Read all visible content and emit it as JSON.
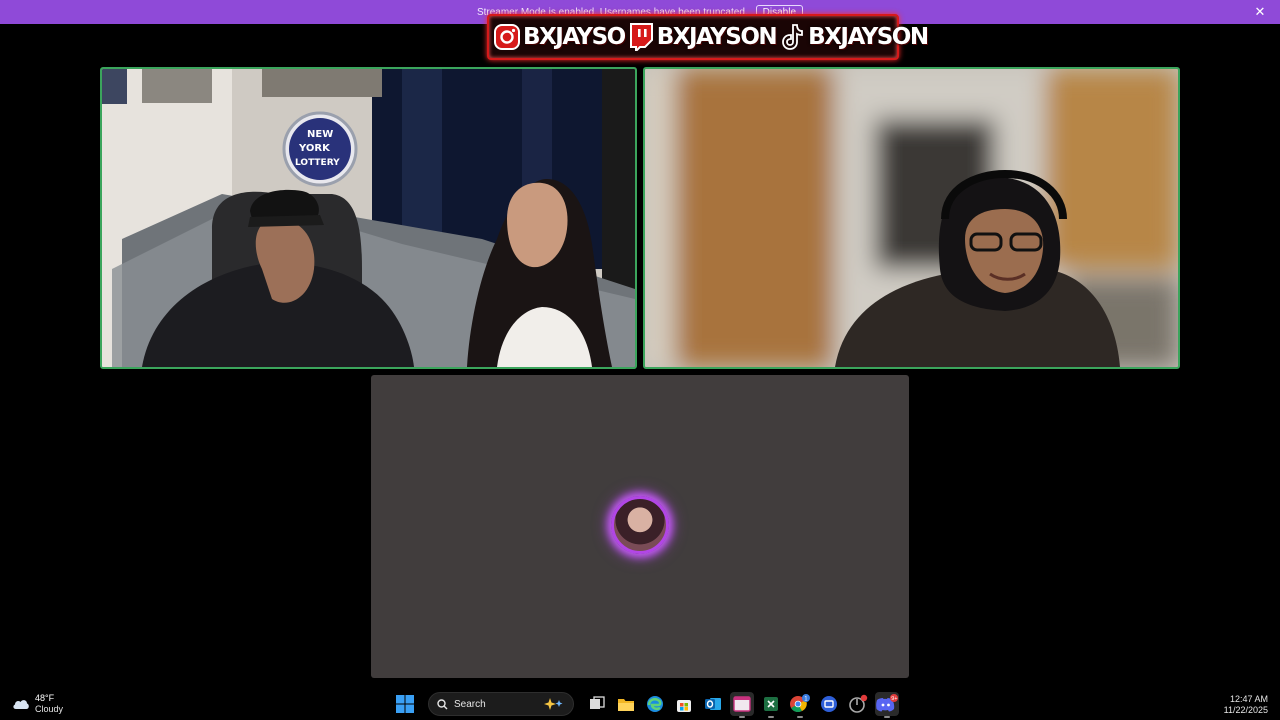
{
  "banner": {
    "message": "Streamer Mode is enabled. Usernames have been truncated.",
    "disable_label": "Disable",
    "close_glyph": "✕",
    "background": "#8f4ad8"
  },
  "overlay": {
    "instagram": {
      "icon": "instagram-icon",
      "handle": "BXJAYSO"
    },
    "twitch": {
      "icon": "twitch-icon",
      "handle": "BXJAYSON"
    },
    "tiktok": {
      "icon": "tiktok-icon",
      "handle": "BXJAYSON"
    },
    "accent": "#d61a1a"
  },
  "tiles": {
    "speaking_border": "#3ba55c",
    "poster_line1": "NEW",
    "poster_line2": "YORK",
    "poster_line3": "LOTTERY",
    "idle_background": "#413d3d",
    "avatar_ring": "#b246e6"
  },
  "taskbar": {
    "weather": {
      "icon": "cloud-icon",
      "temp": "48°F",
      "condition": "Cloudy"
    },
    "search": {
      "placeholder": "Search",
      "icon": "search-icon"
    },
    "apps": [
      "windows-start-icon",
      "task-view-icon",
      "file-explorer-icon",
      "edge-icon",
      "store-icon",
      "outlook-icon",
      "active-window-icon",
      "excel-icon",
      "chrome-icon",
      "remote-app-icon",
      "cursor-app-icon",
      "discord-icon"
    ],
    "chrome_badge": "1",
    "discord_badge": "9+",
    "clock": {
      "time": "12:47 AM",
      "date": "11/22/2025"
    }
  }
}
